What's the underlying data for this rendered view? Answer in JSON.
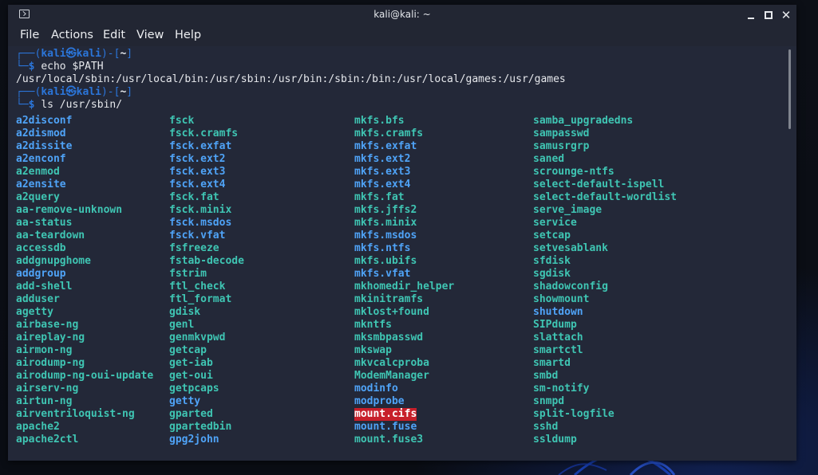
{
  "window": {
    "title": "kali@kali: ~"
  },
  "menu": [
    "File",
    "Actions",
    "Edit",
    "View",
    "Help"
  ],
  "prompt": {
    "user_host_left": "kali",
    "at_symbol": "㉿",
    "user_host_right": "kali",
    "cwd": "~"
  },
  "commands": [
    {
      "command": "echo $PATH",
      "output": "/usr/local/sbin:/usr/local/bin:/usr/sbin:/usr/bin:/sbin:/bin:/usr/local/games:/usr/games"
    },
    {
      "command": "ls /usr/sbin/"
    }
  ],
  "listing": {
    "columns": [
      [
        {
          "name": "a2disconf",
          "type": "link"
        },
        {
          "name": "a2dismod",
          "type": "link"
        },
        {
          "name": "a2dissite",
          "type": "link"
        },
        {
          "name": "a2enconf",
          "type": "link"
        },
        {
          "name": "a2enmod",
          "type": "exec"
        },
        {
          "name": "a2ensite",
          "type": "link"
        },
        {
          "name": "a2query",
          "type": "exec"
        },
        {
          "name": "aa-remove-unknown",
          "type": "exec"
        },
        {
          "name": "aa-status",
          "type": "exec"
        },
        {
          "name": "aa-teardown",
          "type": "exec"
        },
        {
          "name": "accessdb",
          "type": "exec"
        },
        {
          "name": "addgnupghome",
          "type": "exec"
        },
        {
          "name": "addgroup",
          "type": "link"
        },
        {
          "name": "add-shell",
          "type": "exec"
        },
        {
          "name": "adduser",
          "type": "exec"
        },
        {
          "name": "agetty",
          "type": "exec"
        },
        {
          "name": "airbase-ng",
          "type": "exec"
        },
        {
          "name": "aireplay-ng",
          "type": "exec"
        },
        {
          "name": "airmon-ng",
          "type": "exec"
        },
        {
          "name": "airodump-ng",
          "type": "exec"
        },
        {
          "name": "airodump-ng-oui-update",
          "type": "exec"
        },
        {
          "name": "airserv-ng",
          "type": "exec"
        },
        {
          "name": "airtun-ng",
          "type": "exec"
        },
        {
          "name": "airventriloquist-ng",
          "type": "exec"
        },
        {
          "name": "apache2",
          "type": "exec"
        },
        {
          "name": "apache2ctl",
          "type": "exec"
        }
      ],
      [
        {
          "name": "fsck",
          "type": "exec"
        },
        {
          "name": "fsck.cramfs",
          "type": "exec"
        },
        {
          "name": "fsck.exfat",
          "type": "link"
        },
        {
          "name": "fsck.ext2",
          "type": "link"
        },
        {
          "name": "fsck.ext3",
          "type": "link"
        },
        {
          "name": "fsck.ext4",
          "type": "link"
        },
        {
          "name": "fsck.fat",
          "type": "exec"
        },
        {
          "name": "fsck.minix",
          "type": "exec"
        },
        {
          "name": "fsck.msdos",
          "type": "link"
        },
        {
          "name": "fsck.vfat",
          "type": "link"
        },
        {
          "name": "fsfreeze",
          "type": "exec"
        },
        {
          "name": "fstab-decode",
          "type": "exec"
        },
        {
          "name": "fstrim",
          "type": "exec"
        },
        {
          "name": "ftl_check",
          "type": "exec"
        },
        {
          "name": "ftl_format",
          "type": "exec"
        },
        {
          "name": "gdisk",
          "type": "exec"
        },
        {
          "name": "genl",
          "type": "exec"
        },
        {
          "name": "genmkvpwd",
          "type": "exec"
        },
        {
          "name": "getcap",
          "type": "exec"
        },
        {
          "name": "get-iab",
          "type": "exec"
        },
        {
          "name": "get-oui",
          "type": "exec"
        },
        {
          "name": "getpcaps",
          "type": "exec"
        },
        {
          "name": "getty",
          "type": "link"
        },
        {
          "name": "gparted",
          "type": "exec"
        },
        {
          "name": "gpartedbin",
          "type": "exec"
        },
        {
          "name": "gpg2john",
          "type": "link"
        }
      ],
      [
        {
          "name": "mkfs.bfs",
          "type": "exec"
        },
        {
          "name": "mkfs.cramfs",
          "type": "exec"
        },
        {
          "name": "mkfs.exfat",
          "type": "link"
        },
        {
          "name": "mkfs.ext2",
          "type": "link"
        },
        {
          "name": "mkfs.ext3",
          "type": "link"
        },
        {
          "name": "mkfs.ext4",
          "type": "link"
        },
        {
          "name": "mkfs.fat",
          "type": "exec"
        },
        {
          "name": "mkfs.jffs2",
          "type": "exec"
        },
        {
          "name": "mkfs.minix",
          "type": "exec"
        },
        {
          "name": "mkfs.msdos",
          "type": "link"
        },
        {
          "name": "mkfs.ntfs",
          "type": "link"
        },
        {
          "name": "mkfs.ubifs",
          "type": "exec"
        },
        {
          "name": "mkfs.vfat",
          "type": "link"
        },
        {
          "name": "mkhomedir_helper",
          "type": "exec"
        },
        {
          "name": "mkinitramfs",
          "type": "exec"
        },
        {
          "name": "mklost+found",
          "type": "exec"
        },
        {
          "name": "mkntfs",
          "type": "exec"
        },
        {
          "name": "mksmbpasswd",
          "type": "exec"
        },
        {
          "name": "mkswap",
          "type": "exec"
        },
        {
          "name": "mkvcalcproba",
          "type": "exec"
        },
        {
          "name": "ModemManager",
          "type": "exec"
        },
        {
          "name": "modinfo",
          "type": "link"
        },
        {
          "name": "modprobe",
          "type": "link"
        },
        {
          "name": "mount.cifs",
          "type": "highlight"
        },
        {
          "name": "mount.fuse",
          "type": "link"
        },
        {
          "name": "mount.fuse3",
          "type": "exec"
        }
      ],
      [
        {
          "name": "samba_upgradedns",
          "type": "exec"
        },
        {
          "name": "sampasswd",
          "type": "exec"
        },
        {
          "name": "samusrgrp",
          "type": "exec"
        },
        {
          "name": "saned",
          "type": "exec"
        },
        {
          "name": "scrounge-ntfs",
          "type": "exec"
        },
        {
          "name": "select-default-ispell",
          "type": "exec"
        },
        {
          "name": "select-default-wordlist",
          "type": "exec"
        },
        {
          "name": "serve_image",
          "type": "exec"
        },
        {
          "name": "service",
          "type": "exec"
        },
        {
          "name": "setcap",
          "type": "exec"
        },
        {
          "name": "setvesablank",
          "type": "exec"
        },
        {
          "name": "sfdisk",
          "type": "exec"
        },
        {
          "name": "sgdisk",
          "type": "exec"
        },
        {
          "name": "shadowconfig",
          "type": "exec"
        },
        {
          "name": "showmount",
          "type": "exec"
        },
        {
          "name": "shutdown",
          "type": "link"
        },
        {
          "name": "SIPdump",
          "type": "exec"
        },
        {
          "name": "slattach",
          "type": "exec"
        },
        {
          "name": "smartctl",
          "type": "exec"
        },
        {
          "name": "smartd",
          "type": "exec"
        },
        {
          "name": "smbd",
          "type": "exec"
        },
        {
          "name": "sm-notify",
          "type": "exec"
        },
        {
          "name": "snmpd",
          "type": "exec"
        },
        {
          "name": "split-logfile",
          "type": "exec"
        },
        {
          "name": "sshd",
          "type": "exec"
        },
        {
          "name": "ssldump",
          "type": "exec"
        }
      ]
    ]
  },
  "colors": {
    "terminal_bg": "#232838",
    "executable": "#3fc5b3",
    "symlink": "#4fa3f7",
    "highlight_bg": "#c71f2a",
    "prompt_frame": "#2b75d9"
  },
  "icons": {
    "app": "terminal-icon",
    "minimize": "minimize-icon",
    "maximize": "maximize-icon",
    "close": "close-icon"
  }
}
